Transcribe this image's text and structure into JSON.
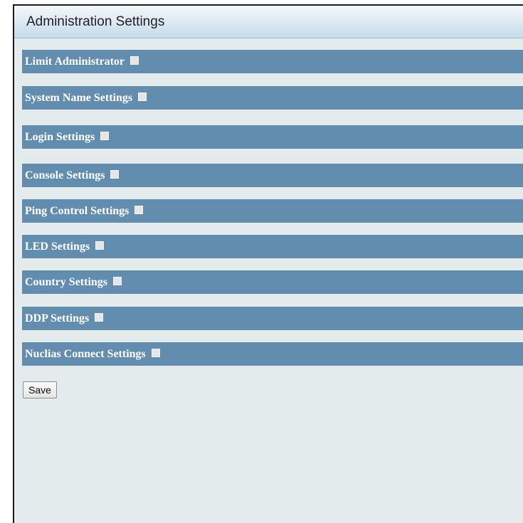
{
  "panel": {
    "title": "Administration Settings"
  },
  "sections": [
    {
      "label": "Limit Administrator",
      "checked": false
    },
    {
      "label": "System Name Settings",
      "checked": false
    },
    {
      "label": "Login Settings",
      "checked": false
    },
    {
      "label": "Console Settings",
      "checked": false
    },
    {
      "label": "Ping Control Settings",
      "checked": false
    },
    {
      "label": "LED Settings",
      "checked": false
    },
    {
      "label": "Country Settings",
      "checked": false
    },
    {
      "label": "DDP Settings",
      "checked": false
    },
    {
      "label": "Nuclias Connect Settings",
      "checked": false
    }
  ],
  "actions": {
    "save_label": "Save"
  },
  "colors": {
    "section_bar": "#628daf",
    "panel_background": "#e3ebec"
  }
}
